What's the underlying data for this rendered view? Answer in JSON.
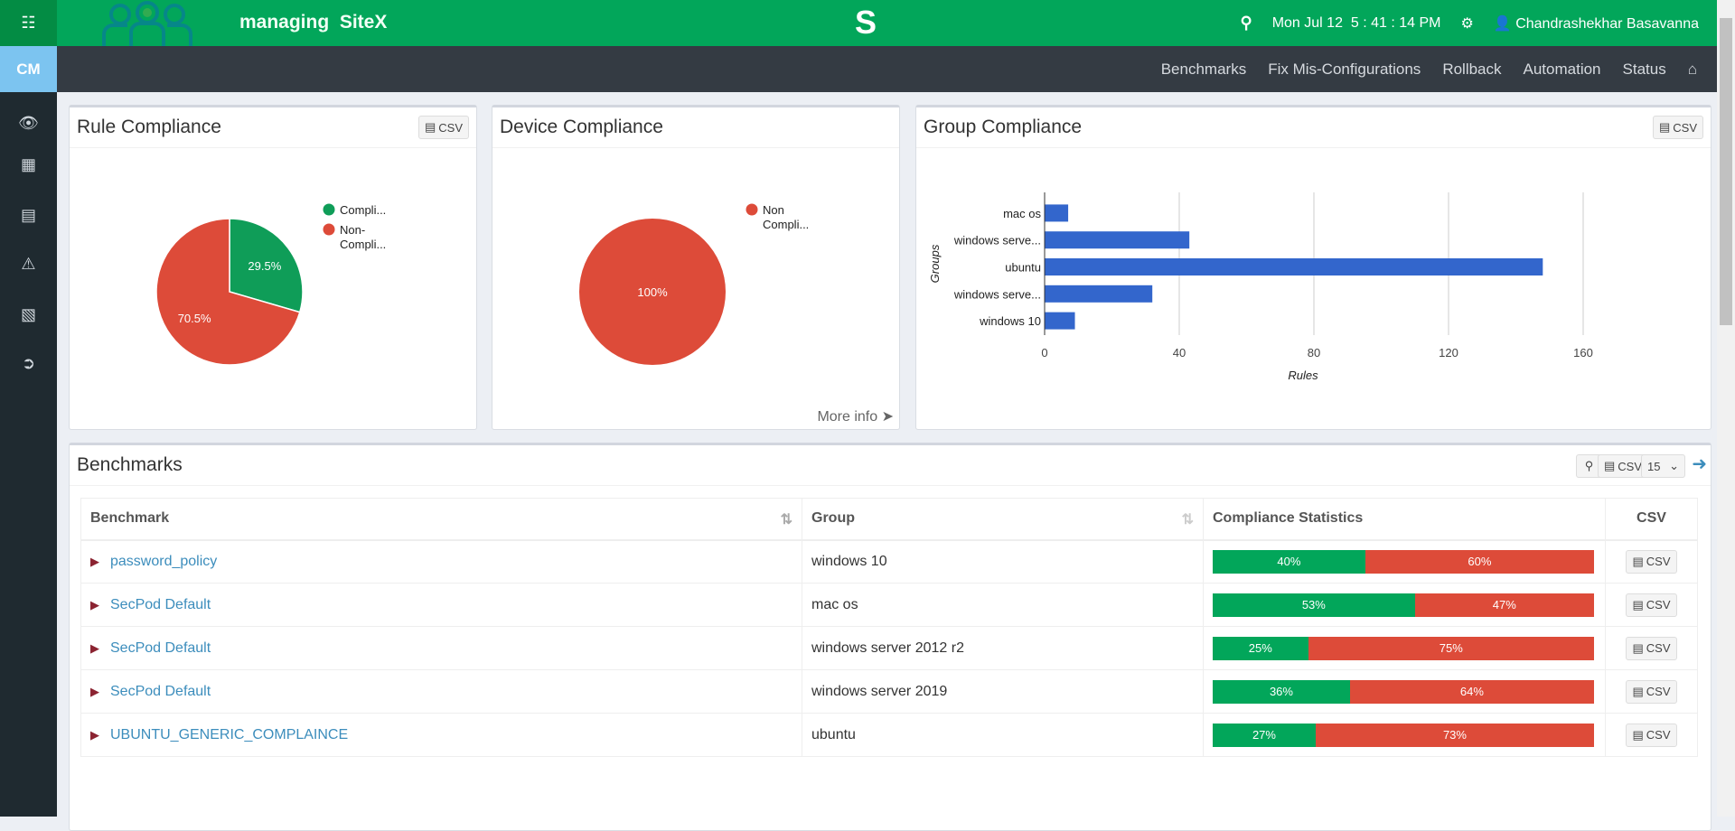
{
  "header": {
    "title": "managing  SiteX",
    "logo_letter": "S",
    "datetime": "Mon Jul 12  5 : 41 : 14 PM",
    "user": "Chandrashekhar Basavanna",
    "search_icon": "search-icon",
    "settings_icon": "gears-icon",
    "user_icon": "user-icon"
  },
  "sidebar": {
    "module": "CM",
    "items": [
      "sitemap-icon",
      "eye-icon",
      "briefcase-icon",
      "list-icon",
      "warning-icon",
      "book-icon",
      "sign-out-icon"
    ]
  },
  "nav": {
    "items": [
      "Benchmarks",
      "Fix Mis-Configurations",
      "Rollback",
      "Automation",
      "Status"
    ],
    "home_icon": "home-icon"
  },
  "colors": {
    "green": "#02a65a",
    "red": "#dd4b39",
    "blue": "#3366cc"
  },
  "panels": {
    "rule": {
      "title": "Rule Compliance",
      "csv": "CSV"
    },
    "device": {
      "title": "Device Compliance",
      "more_info": "More info"
    },
    "group": {
      "title": "Group Compliance",
      "csv": "CSV"
    }
  },
  "chart_data": [
    {
      "type": "pie",
      "title": "Rule Compliance",
      "slices": [
        {
          "name": "Compli...",
          "value": 29.5,
          "label": "29.5%",
          "color": "#0f9d58"
        },
        {
          "name": "Non-Compli...",
          "value": 70.5,
          "label": "70.5%",
          "color": "#dd4b39"
        }
      ],
      "legend": "right"
    },
    {
      "type": "pie",
      "title": "Device Compliance",
      "slices": [
        {
          "name": "Non Compli...",
          "value": 100,
          "label": "100%",
          "color": "#dd4b39"
        }
      ],
      "legend": "right"
    },
    {
      "type": "bar",
      "orientation": "horizontal",
      "title": "Group Compliance",
      "categories": [
        "mac os",
        "windows serve...",
        "ubuntu",
        "windows serve...",
        "windows 10"
      ],
      "values": [
        7,
        43,
        148,
        32,
        9
      ],
      "xlabel": "Rules",
      "ylabel": "Groups",
      "xlim": [
        0,
        160
      ],
      "xticks": [
        "0",
        "40",
        "80",
        "120",
        "160"
      ],
      "grid": true
    }
  ],
  "benchmarks": {
    "title": "Benchmarks",
    "csv": "CSV",
    "page_size": "15",
    "columns": [
      "Benchmark",
      "Group",
      "Compliance Statistics",
      "CSV"
    ],
    "rows": [
      {
        "name": "password_policy",
        "group": "windows 10",
        "pass": 40,
        "fail": 60,
        "pass_label": "40%",
        "fail_label": "60%",
        "csv": "CSV"
      },
      {
        "name": "SecPod Default",
        "group": "mac os",
        "pass": 53,
        "fail": 47,
        "pass_label": "53%",
        "fail_label": "47%",
        "csv": "CSV"
      },
      {
        "name": "SecPod Default",
        "group": "windows server 2012 r2",
        "pass": 25,
        "fail": 75,
        "pass_label": "25%",
        "fail_label": "75%",
        "csv": "CSV"
      },
      {
        "name": "SecPod Default",
        "group": "windows server 2019",
        "pass": 36,
        "fail": 64,
        "pass_label": "36%",
        "fail_label": "64%",
        "csv": "CSV"
      },
      {
        "name": "UBUNTU_GENERIC_COMPLAINCE",
        "group": "ubuntu",
        "pass": 27,
        "fail": 73,
        "pass_label": "27%",
        "fail_label": "73%",
        "csv": "CSV"
      }
    ]
  }
}
